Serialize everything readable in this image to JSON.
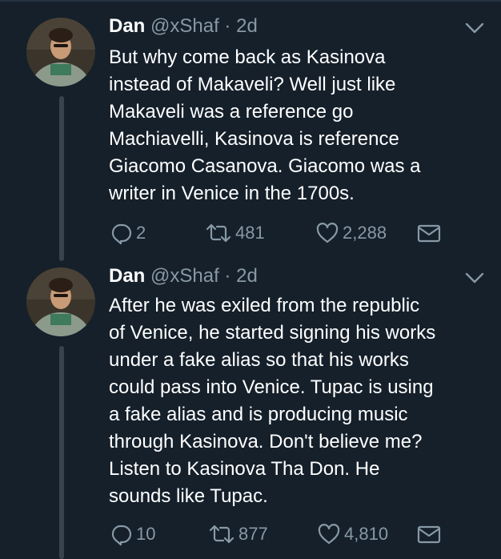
{
  "tweets": [
    {
      "name": "Dan",
      "handle": "@xShaf",
      "sep": "·",
      "time": "2d",
      "lines": [
        "But why come back as Kasinova",
        "instead of Makaveli? Well just like",
        "Makaveli was a reference go",
        "Machiavelli, Kasinova is reference",
        "Giacomo Casanova. Giacomo was a",
        "writer in Venice in the 1700s."
      ],
      "replies": "2",
      "retweets": "481",
      "likes": "2,288"
    },
    {
      "name": "Dan",
      "handle": "@xShaf",
      "sep": "·",
      "time": "2d",
      "lines": [
        "After he was exiled from the republic",
        "of Venice, he started signing his works",
        "under a fake alias so that his works",
        "could pass into Venice. Tupac is using",
        "a fake alias and is producing music",
        "through Kasinova. Don't believe me?",
        "Listen to Kasinova Tha Don. He",
        "sounds like Tupac."
      ],
      "replies": "10",
      "retweets": "877",
      "likes": "4,810"
    }
  ],
  "icons": [
    "chevron-down-icon",
    "reply-icon",
    "retweet-icon",
    "like-icon",
    "message-icon"
  ],
  "colors": {
    "background": "#15202b",
    "muted": "#8899a6",
    "thread_line": "#38444d",
    "text": "#ffffff"
  }
}
